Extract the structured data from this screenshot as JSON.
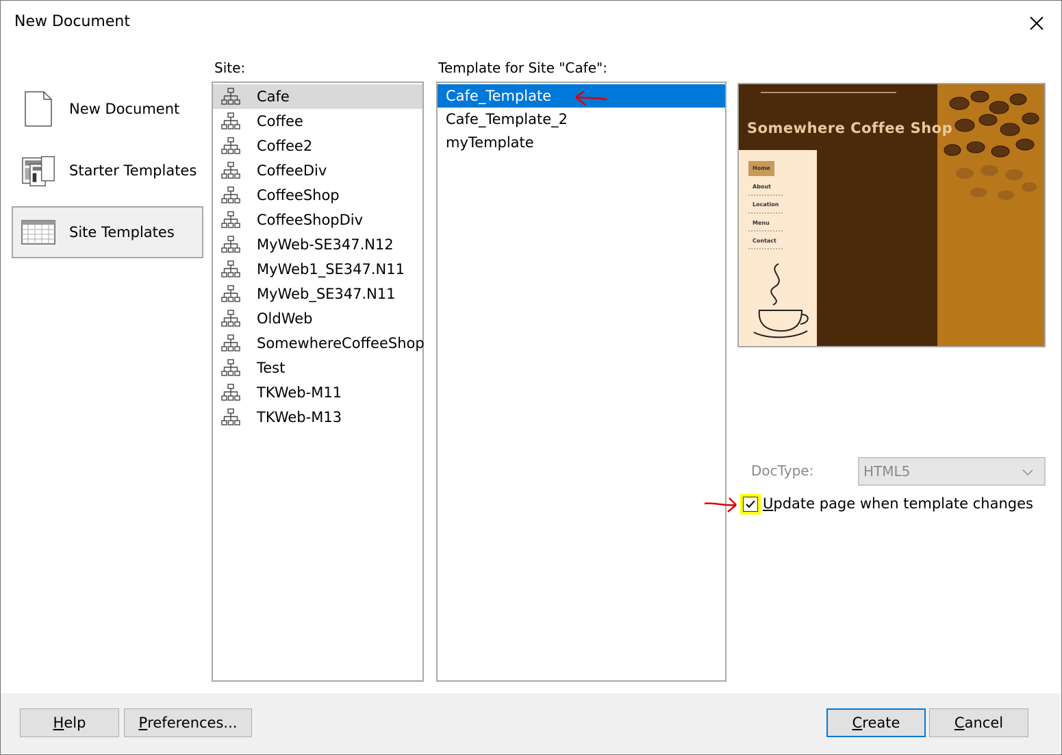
{
  "window": {
    "title": "New Document"
  },
  "categories": [
    {
      "label": "New Document",
      "icon": "blank-document-icon"
    },
    {
      "label": "Starter Templates",
      "icon": "starter-templates-icon"
    },
    {
      "label": "Site Templates",
      "icon": "site-templates-icon",
      "selected": true
    }
  ],
  "site_list": {
    "label": "Site:",
    "items": [
      "Cafe",
      "Coffee",
      "Coffee2",
      "CoffeeDiv",
      "CoffeeShop",
      "CoffeeShopDiv",
      "MyWeb-SE347.N12",
      "MyWeb1_SE347.N11",
      "MyWeb_SE347.N11",
      "OldWeb",
      "SomewhereCoffeeShop",
      "Test",
      "TKWeb-M11",
      "TKWeb-M13"
    ],
    "selected": "Cafe"
  },
  "template_list": {
    "label": "Template for Site \"Cafe\":",
    "items": [
      "Cafe_Template",
      "Cafe_Template_2",
      "myTemplate"
    ],
    "selected": "Cafe_Template"
  },
  "preview": {
    "heading": "Somewhere Coffee Shop",
    "nav": [
      "Home",
      "About",
      "Location",
      "Menu",
      "Contact"
    ]
  },
  "doctype": {
    "label": "DocType:",
    "value": "HTML5"
  },
  "update_checkbox": {
    "label_rest": "pdate page when template changes",
    "mnemonic": "U",
    "checked": true
  },
  "buttons": {
    "help": {
      "mnemonic": "H",
      "rest": "elp"
    },
    "preferences": {
      "mnemonic": "P",
      "rest": "references..."
    },
    "create": {
      "mnemonic": "C",
      "rest": "reate"
    },
    "cancel": {
      "mnemonic": "C",
      "rest": "ancel"
    }
  },
  "colors": {
    "selection_blue": "#0078d7",
    "highlight_yellow": "#ffff00",
    "annotation_red": "#e00000",
    "preview_dark": "#4a2a0a",
    "preview_gold": "#b8771a",
    "preview_cream": "#fde8d0"
  }
}
